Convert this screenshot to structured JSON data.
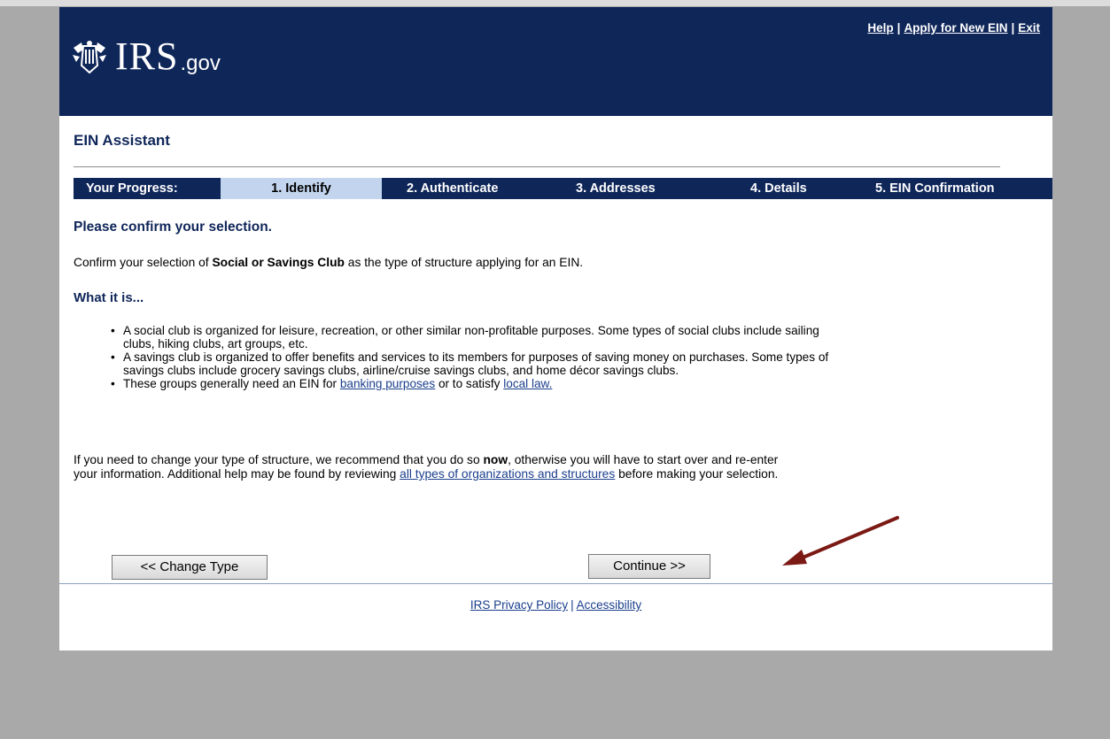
{
  "header": {
    "logo_text": "IRS",
    "logo_suffix": ".gov",
    "links": {
      "help": "Help",
      "apply": "Apply for New EIN",
      "exit": "Exit",
      "sep": "|"
    }
  },
  "app_title": "EIN Assistant",
  "progress": {
    "label": "Your Progress:",
    "steps": [
      "1. Identify",
      "2. Authenticate",
      "3. Addresses",
      "4. Details",
      "5. EIN Confirmation"
    ],
    "active_step": "1. Identify"
  },
  "main": {
    "heading": "Please confirm your selection.",
    "confirm_pre": "Confirm your selection of ",
    "confirm_bold": "Social or Savings Club",
    "confirm_post": " as the type of structure applying for an EIN.",
    "what_heading": "What it is...",
    "bullet1": "A social club is organized for leisure, recreation, or other similar non-profitable purposes. Some types of social clubs include sailing clubs, hiking clubs, art groups, etc.",
    "bullet2": "A savings club is organized to offer benefits and services to its members for purposes of saving money on purchases. Some types of savings clubs include grocery savings clubs, airline/cruise savings clubs, and home décor savings clubs.",
    "bullet3_pre": "These groups generally need an EIN for ",
    "bullet3_link1": "banking purposes",
    "bullet3_mid": " or to satisfy ",
    "bullet3_link2": "local law.",
    "change_pre": "If you need to change your type of structure, we recommend that you do so ",
    "change_bold": "now",
    "change_mid": ", otherwise you will have to start over and re-enter your information.  Additional help may be found by reviewing ",
    "change_link": "all types of organizations and structures",
    "change_post": " before making your selection."
  },
  "buttons": {
    "change_type": "<< Change Type",
    "continue": "Continue >>"
  },
  "footer": {
    "privacy": "IRS Privacy Policy",
    "sep": "|",
    "accessibility": "Accessibility"
  },
  "colors": {
    "navy": "#0f2659",
    "active_step_bg": "#c3d5ee",
    "arrow": "#7b1a14",
    "link": "#1a3e8c"
  },
  "icons": {
    "logo": "irs-eagle-icon",
    "annotation": "red-arrow-icon"
  }
}
